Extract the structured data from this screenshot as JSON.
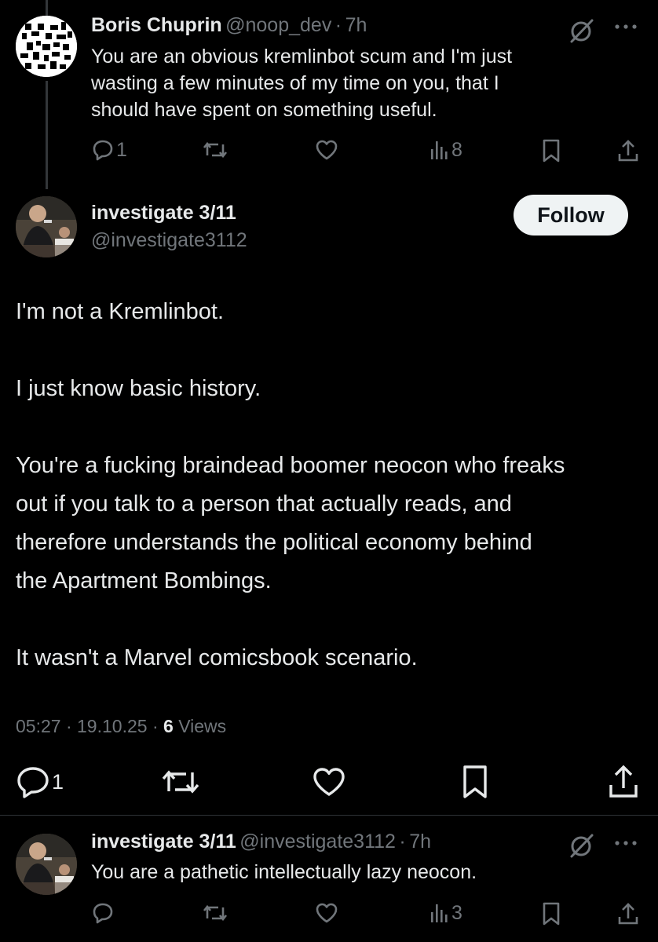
{
  "reply_top": {
    "author_name": "Boris Chuprin",
    "author_handle": "@noop_dev",
    "sep": "·",
    "time": "7h",
    "text_lines": [
      "You are an obvious kremlinbot scum and I'm just",
      "wasting a few minutes of my time on you, that I",
      "should have spent on something useful."
    ],
    "replies": "1",
    "views": "8"
  },
  "main_post": {
    "author_name": "investigate 3/11",
    "author_handle": "@investigate3112",
    "follow_label": "Follow",
    "paragraphs": [
      [
        "I'm not a Kremlinbot."
      ],
      [
        "I just know basic history."
      ],
      [
        "You're a fucking braindead boomer neocon who freaks",
        "out if you talk to a person that actually reads, and",
        "therefore understands the political economy behind",
        "the Apartment Bombings."
      ],
      [
        "It wasn't a Marvel comicsbook scenario."
      ]
    ],
    "time": "05:27",
    "date": "19.10.25",
    "views_count": "6",
    "views_label": "Views",
    "replies": "1"
  },
  "reply_bottom": {
    "author_name": "investigate 3/11",
    "author_handle": "@investigate3112",
    "sep": "·",
    "time": "7h",
    "text": "You are a pathetic intellectually lazy neocon.",
    "views": "3"
  },
  "colors": {
    "background": "#000000",
    "text": "#e7e9ea",
    "muted": "#71767b",
    "follow_bg": "#eff3f4"
  }
}
